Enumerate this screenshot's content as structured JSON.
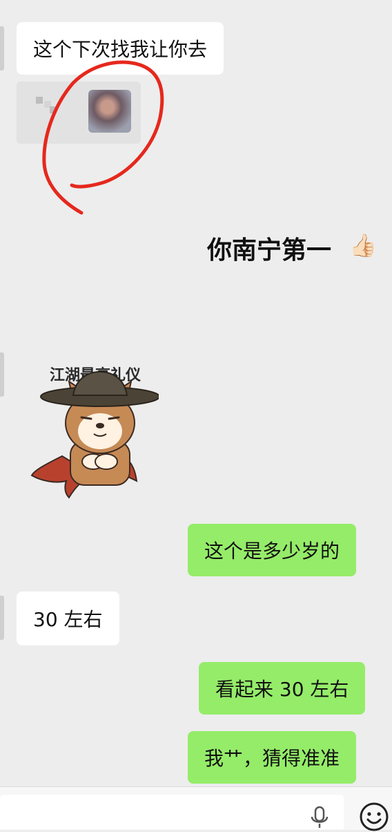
{
  "messages": [
    {
      "dir": "in",
      "text": "这个下次找我让你去"
    },
    {
      "dir": "out",
      "text": "你南宁第一",
      "emoji": "👍🏻"
    },
    {
      "dir": "in",
      "sticker": "江湖最高礼仪"
    },
    {
      "dir": "out",
      "text": "这个是多少岁的"
    },
    {
      "dir": "in",
      "text": "30 左右"
    },
    {
      "dir": "out",
      "text": "看起来 30 左右"
    },
    {
      "dir": "out",
      "text": "我艹，猜得准准"
    }
  ],
  "colors": {
    "background": "#ededed",
    "incoming_bubble": "#ffffff",
    "outgoing_bubble": "#95ec69",
    "annotation_circle": "#e5281d"
  },
  "icons": [
    "mic-icon",
    "emoji-icon"
  ]
}
